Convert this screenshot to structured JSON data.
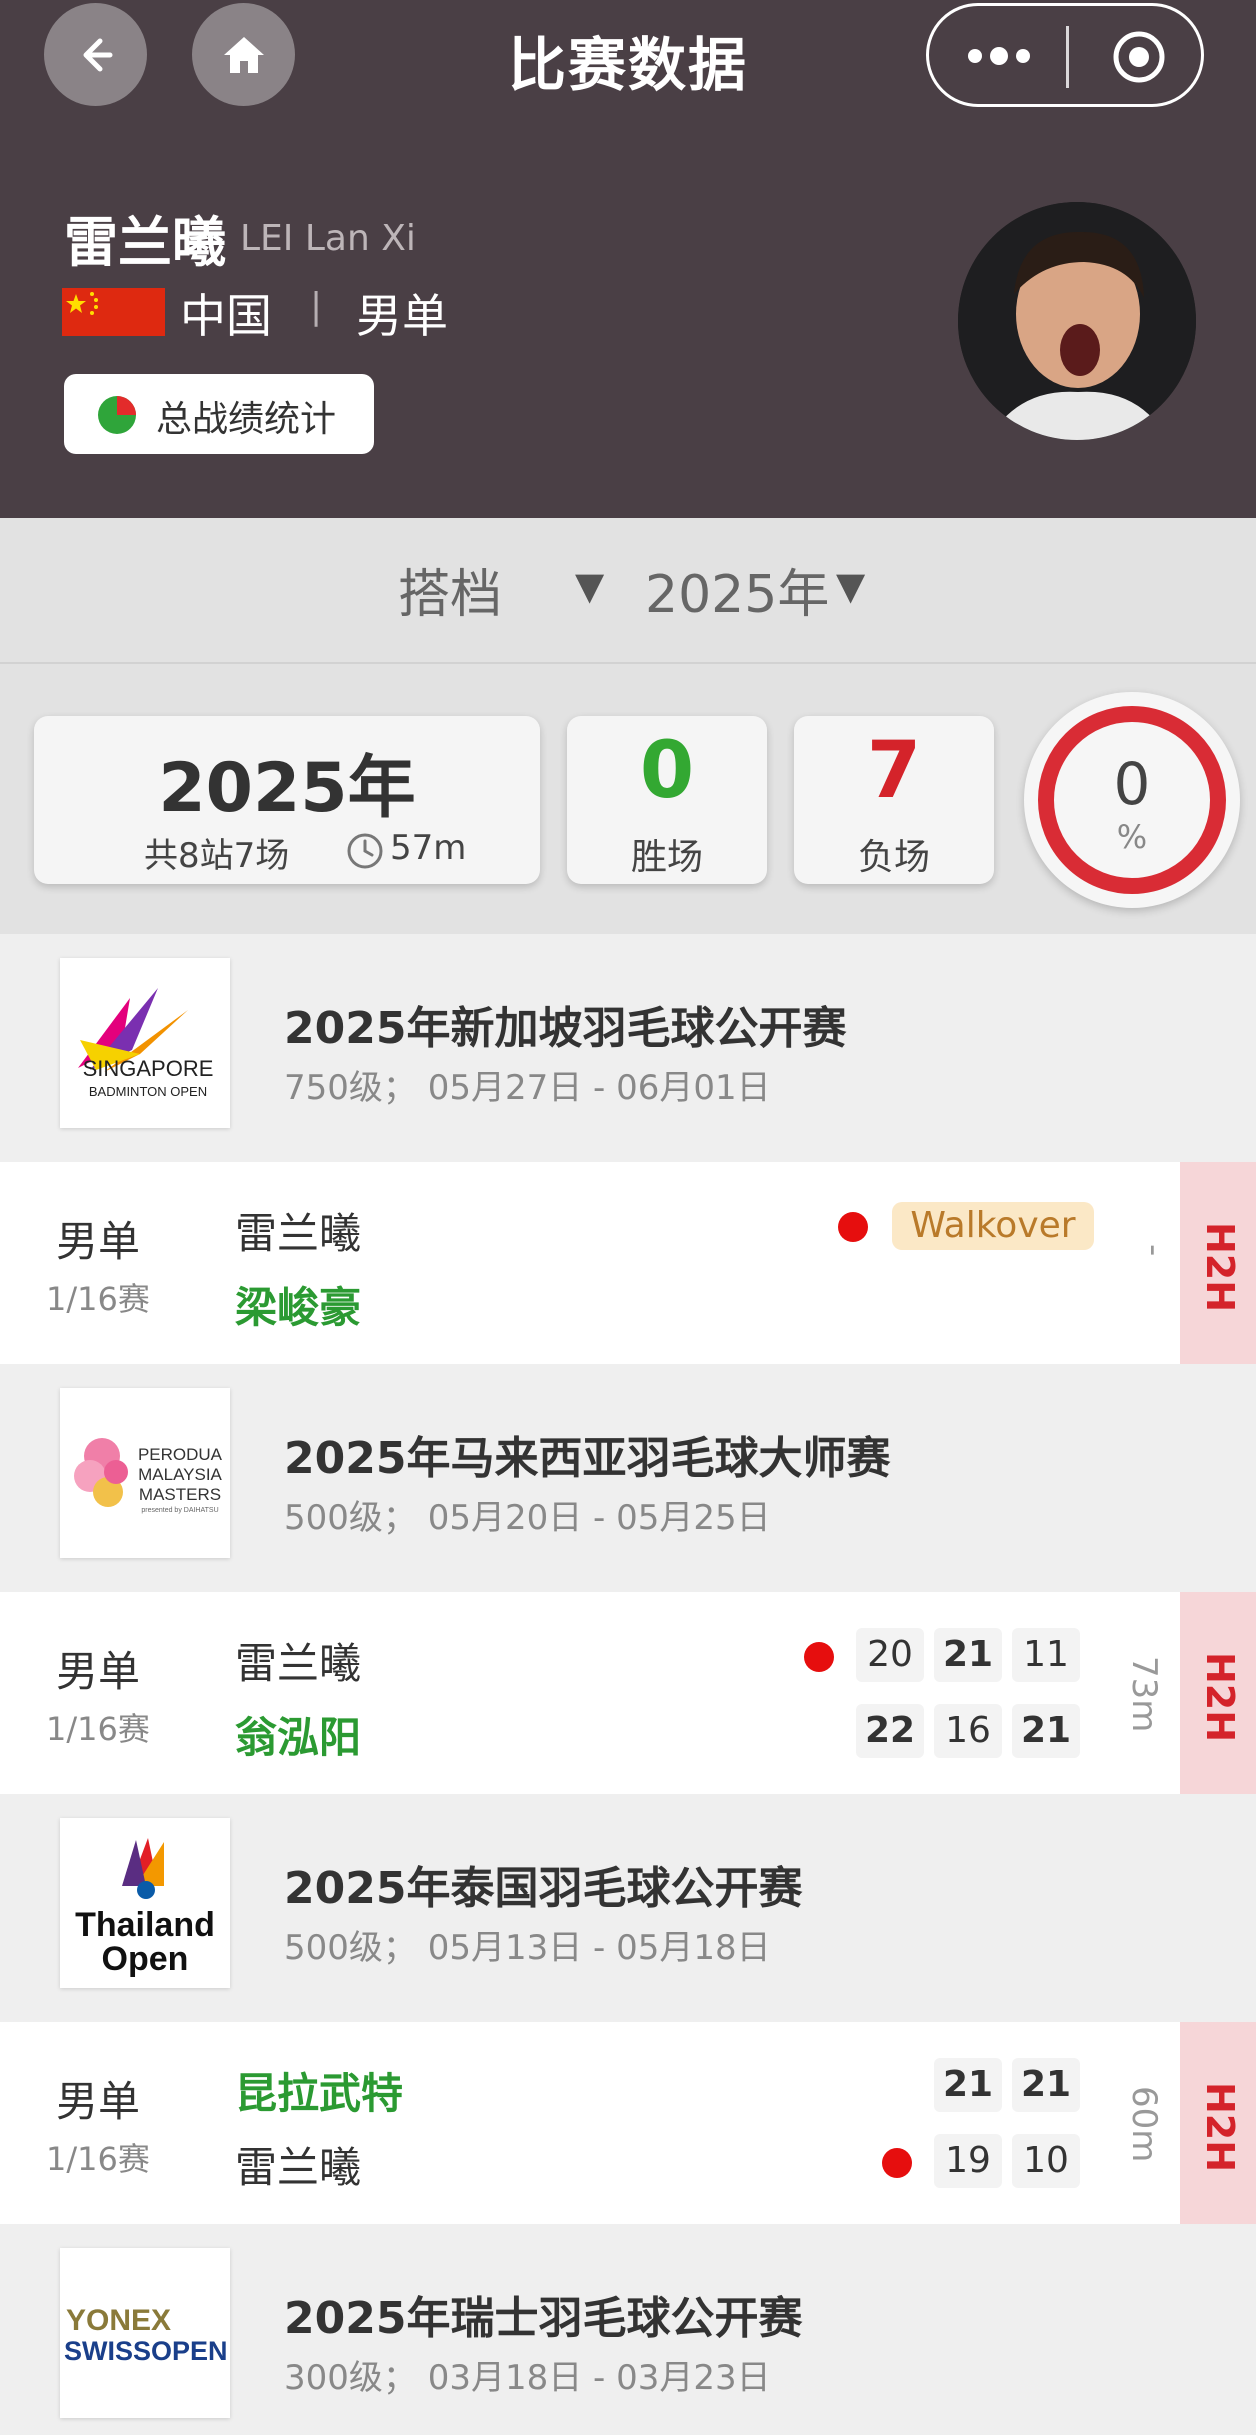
{
  "nav": {
    "title": "比赛数据"
  },
  "player": {
    "name_cn": "雷兰曦",
    "name_en": "LEI Lan Xi",
    "country": "中国",
    "event": "男单",
    "stats_button": "总战绩统计"
  },
  "filter": {
    "partner": "搭档",
    "year": "2025年"
  },
  "summary": {
    "year": "2025年",
    "subtitle": "共8站7场",
    "duration": "57m",
    "wins": "0",
    "wins_label": "胜场",
    "losses": "7",
    "losses_label": "负场",
    "win_rate": "0",
    "win_rate_unit": "%"
  },
  "tournaments": [
    {
      "name": "2025年新加坡羽毛球公开赛",
      "meta": "750级；  05月27日 - 06月01日",
      "logo_text": [
        "SINGAPORE",
        "BADMINTON OPEN"
      ],
      "match": {
        "type": "男单",
        "round": "1/16赛",
        "player_top": "雷兰曦",
        "player_bottom": "梁峻豪",
        "badge": "Walkover",
        "duration": "-",
        "h2h": "H2H"
      }
    },
    {
      "name": "2025年马来西亚羽毛球大师赛",
      "meta": "500级；  05月20日 - 05月25日",
      "logo_text": [
        "PERODUA",
        "MALAYSIA",
        "MASTERS",
        "presented by DAIHATSU"
      ],
      "match": {
        "type": "男单",
        "round": "1/16赛",
        "player_top": "雷兰曦",
        "player_bottom": "翁泓阳",
        "scores_top": [
          "20",
          "21",
          "11"
        ],
        "scores_bottom": [
          "22",
          "16",
          "21"
        ],
        "duration": "73m",
        "h2h": "H2H"
      }
    },
    {
      "name": "2025年泰国羽毛球公开赛",
      "meta": "500级；  05月13日 - 05月18日",
      "logo_text": [
        "Thailand",
        "Open"
      ],
      "match": {
        "type": "男单",
        "round": "1/16赛",
        "player_top": "昆拉武特",
        "player_bottom": "雷兰曦",
        "scores_top": [
          "21",
          "21"
        ],
        "scores_bottom": [
          "19",
          "10"
        ],
        "duration": "60m",
        "h2h": "H2H"
      }
    },
    {
      "name": "2025年瑞士羽毛球公开赛",
      "meta": "300级；  03月18日 - 03月23日",
      "logo_text": [
        "YONEX",
        "SWISSOPEN"
      ]
    }
  ],
  "colors": {
    "header_bg": "#4a3f45",
    "win_green": "#2b9a32",
    "loss_red": "#d4232a",
    "h2h_bg": "#f6d6d8"
  }
}
